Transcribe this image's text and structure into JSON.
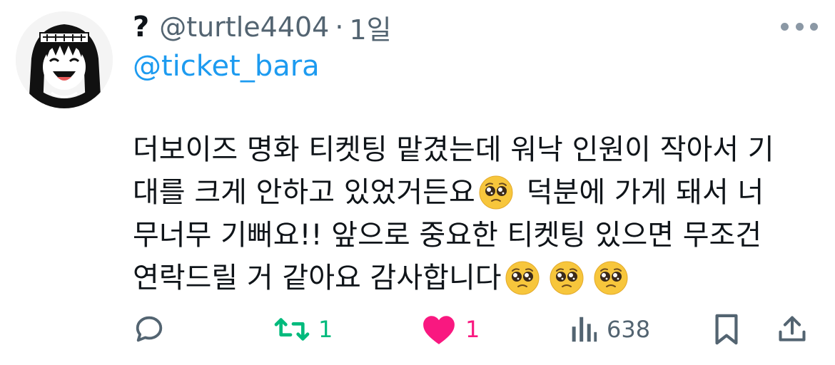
{
  "author": {
    "display_name": "?",
    "handle": "@turtle4404",
    "separator": "·",
    "time": "1일",
    "avatar_icon": "anime-avatar-icon"
  },
  "reply_to": "@ticket_bara",
  "body": {
    "line1": "더보이즈 명화 티켓팅 맡겼는데 워낙 인원이 작아서 기",
    "line2_a": "대를 크게 안하고 있었거든요",
    "line2_b": "덕분에 가게 돼서 너",
    "line3": "무너무 기뻐요!! 앞으로 중요한 티켓팅 있으면 무조건",
    "line4": "연락드릴 거 같아요 감사합니다",
    "emoji_name": "pleading-face-icon"
  },
  "actions": {
    "reply_icon": "reply-icon",
    "retweet_icon": "retweet-icon",
    "retweet_count": "1",
    "like_icon": "heart-icon",
    "like_count": "1",
    "views_icon": "views-icon",
    "views_count": "638",
    "bookmark_icon": "bookmark-icon",
    "share_icon": "share-icon"
  },
  "colors": {
    "text": "#0f1419",
    "secondary": "#536471",
    "link": "#1d9bf0",
    "retweet": "#00ba7c",
    "like": "#f91880"
  }
}
